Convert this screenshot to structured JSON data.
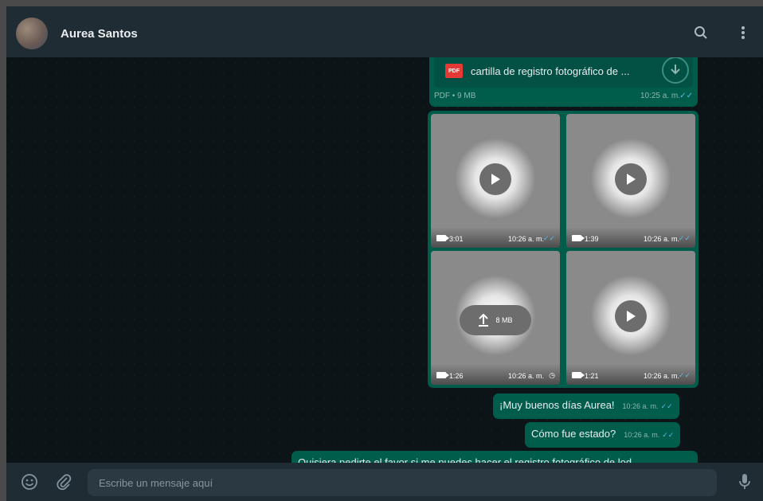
{
  "header": {
    "contact_name": "Aurea Santos",
    "icons": [
      "search-icon",
      "menu-icon"
    ]
  },
  "pdf_message": {
    "file_name": "cartilla de registro fotográfico de ...",
    "badge": "PDF",
    "meta": "PDF • 9 MB",
    "time": "10:25 a. m.",
    "status": "read"
  },
  "media_messages": [
    {
      "duration": "3:01",
      "time": "10:26 a. m.",
      "status": "read",
      "state": "play"
    },
    {
      "duration": "1:39",
      "time": "10:26 a. m.",
      "status": "read",
      "state": "play"
    },
    {
      "duration": "1:26",
      "time": "10:26 a. m.",
      "status": "pending",
      "state": "upload",
      "upload_label": "8 MB"
    },
    {
      "duration": "1:21",
      "time": "10:26 a. m.",
      "status": "read",
      "state": "play"
    }
  ],
  "text_messages": [
    {
      "text": "¡Muy buenos días Aurea!",
      "time": "10:26 a. m."
    },
    {
      "text": "Cómo fue estado?",
      "time": "10:26 a. m."
    },
    {
      "text": "Quisiera pedirte el favor si me puedes hacer el registro fotográfico de lod",
      "time": ""
    }
  ],
  "composer": {
    "placeholder": "Escribe un mensaje aquí",
    "value": ""
  },
  "colors": {
    "outgoing_bubble": "#005c4b",
    "header": "#202c33",
    "read_tick": "#53bdeb",
    "pdf_red": "#e53935"
  }
}
